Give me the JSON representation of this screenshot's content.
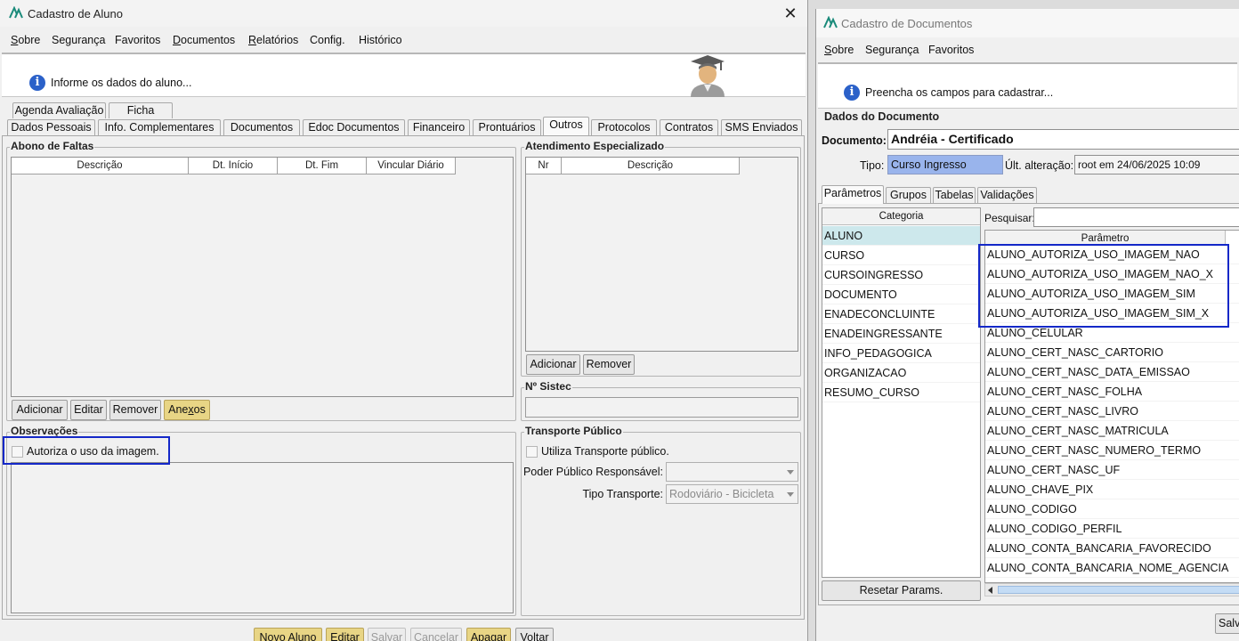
{
  "win1": {
    "title": "Cadastro de Aluno",
    "menu": [
      {
        "pre": "",
        "u": "S",
        "post": "obre"
      },
      {
        "pre": "Segurança",
        "u": "",
        "post": ""
      },
      {
        "pre": "Favoritos",
        "u": "",
        "post": ""
      },
      {
        "pre": "",
        "u": "D",
        "post": "ocumentos"
      },
      {
        "pre": "",
        "u": "R",
        "post": "elatórios"
      },
      {
        "pre": "Config.",
        "u": "",
        "post": ""
      },
      {
        "pre": "Histórico",
        "u": "",
        "post": ""
      }
    ],
    "info_text": "Informe os dados do aluno...",
    "tabs_row1": [
      "Agenda Avaliação",
      "Ficha Saúde"
    ],
    "tabs_row2": [
      "Dados Pessoais",
      "Info. Complementares",
      "Documentos",
      "Edoc Documentos",
      "Financeiro",
      "Prontuários",
      "Outros",
      "Protocolos",
      "Contratos",
      "SMS Enviados"
    ],
    "active_tab": "Outros",
    "abono": {
      "title": "Abono de Faltas",
      "columns": [
        "Descrição",
        "Dt. Início",
        "Dt. Fim",
        "Vincular Diário"
      ],
      "buttons": {
        "add": "Adicionar",
        "edit": "Editar",
        "remove": "Remover",
        "attach_pre": "Ane",
        "attach_u": "x",
        "attach_post": "os"
      }
    },
    "atendimento": {
      "title": "Atendimento Especializado",
      "columns": [
        "Nr",
        "Descrição"
      ],
      "buttons": {
        "add": "Adicionar",
        "remove": "Remover"
      }
    },
    "sistec": {
      "title": "Nº Sistec",
      "value": ""
    },
    "observacoes": {
      "title": "Observações",
      "checkbox_label": "Autoriza o uso da imagem.",
      "checked": false
    },
    "transporte": {
      "title": "Transporte Público",
      "checkbox_label": "Utiliza Transporte público.",
      "poder_label": "Poder Público Responsável:",
      "poder_value": "",
      "tipo_label": "Tipo Transporte:",
      "tipo_value": "Rodoviário - Bicicleta"
    },
    "bottom_buttons": {
      "novo": "Novo Aluno",
      "editar": "Editar",
      "salvar": "Salvar",
      "cancelar": "Cancelar",
      "apagar": "Apagar",
      "voltar": "Voltar"
    }
  },
  "win2": {
    "title": "Cadastro de Documentos",
    "menu": [
      {
        "pre": "",
        "u": "S",
        "post": "obre"
      },
      {
        "pre": "Segurança",
        "u": "",
        "post": ""
      },
      {
        "pre": "Favoritos",
        "u": "",
        "post": ""
      }
    ],
    "info_text": "Preencha os campos para cadastrar...",
    "group_title": "Dados do Documento",
    "documento_label": "Documento:",
    "documento_value": "Andréia - Certificado",
    "tipo_label": "Tipo:",
    "tipo_value": "Curso Ingresso",
    "ult_label": "Últ. alteração:",
    "ult_value": "root em 24/06/2025 10:09",
    "tabs": [
      "Parâmetros",
      "Grupos",
      "Tabelas",
      "Validações"
    ],
    "active_tab": "Parâmetros",
    "categoria_header": "Categoria",
    "categorias": [
      "ALUNO",
      "CURSO",
      "CURSOINGRESSO",
      "DOCUMENTO",
      "ENADECONCLUINTE",
      "ENADEINGRESSANTE",
      "INFO_PEDAGOGICA",
      "ORGANIZACAO",
      "RESUMO_CURSO"
    ],
    "selected_categoria": "ALUNO",
    "pesquisar_label": "Pesquisar:",
    "pesquisar_value": "",
    "parametro_header": "Parâmetro",
    "parametros": [
      "ALUNO_AUTORIZA_USO_IMAGEM_NAO",
      "ALUNO_AUTORIZA_USO_IMAGEM_NAO_X",
      "ALUNO_AUTORIZA_USO_IMAGEM_SIM",
      "ALUNO_AUTORIZA_USO_IMAGEM_SIM_X",
      "ALUNO_CELULAR",
      "ALUNO_CERT_NASC_CARTORIO",
      "ALUNO_CERT_NASC_DATA_EMISSAO",
      "ALUNO_CERT_NASC_FOLHA",
      "ALUNO_CERT_NASC_LIVRO",
      "ALUNO_CERT_NASC_MATRICULA",
      "ALUNO_CERT_NASC_NUMERO_TERMO",
      "ALUNO_CERT_NASC_UF",
      "ALUNO_CHAVE_PIX",
      "ALUNO_CODIGO",
      "ALUNO_CODIGO_PERFIL",
      "ALUNO_CONTA_BANCARIA_FAVORECIDO",
      "ALUNO_CONTA_BANCARIA_NOME_AGENCIA"
    ],
    "reset_button": "Resetar Params.",
    "save_button": "Salva"
  },
  "colors": {
    "highlight": "#1428c8",
    "selected_row": "#cde8ec",
    "tipo_bg": "#99b4ec",
    "yellow_button": "#e8d585"
  }
}
